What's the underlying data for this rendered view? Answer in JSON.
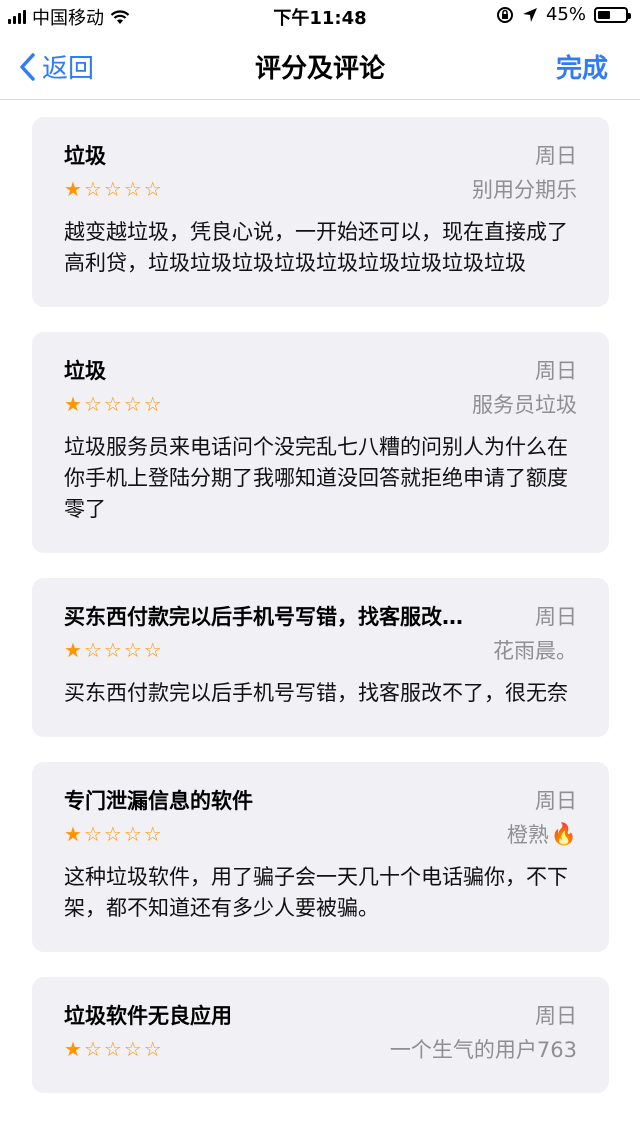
{
  "status_bar": {
    "carrier": "中国移动",
    "time": "下午11:48",
    "battery": "45%",
    "battery_level": 0.45
  },
  "nav": {
    "back_label": "返回",
    "title": "评分及评论",
    "done_label": "完成"
  },
  "reviews": [
    {
      "title": "垃圾",
      "date": "周日",
      "rating": 1,
      "author": "别用分期乐",
      "body": "越变越垃圾，凭良心说，一开始还可以，现在直接成了高利贷，垃圾垃圾垃圾垃圾垃圾垃圾垃圾垃圾垃圾"
    },
    {
      "title": "垃圾",
      "date": "周日",
      "rating": 1,
      "author": "服务员垃圾",
      "body": "垃圾服务员来电话问个没完乱七八糟的问别人为什么在你手机上登陆分期了我哪知道没回答就拒绝申请了额度零了"
    },
    {
      "title": "买东西付款完以后手机号写错，找客服改…",
      "date": "周日",
      "rating": 1,
      "author": "花雨晨。",
      "body": "买东西付款完以后手机号写错，找客服改不了，很无奈"
    },
    {
      "title": "专门泄漏信息的软件",
      "date": "周日",
      "rating": 1,
      "author": "橙熟",
      "author_emoji": "🔥",
      "body": "这种垃圾软件，用了骗子会一天几十个电话骗你，不下架，都不知道还有多少人要被骗。"
    },
    {
      "title": "垃圾软件无良应用",
      "date": "周日",
      "rating": 1,
      "author": "一个生气的用户763",
      "body": ""
    }
  ],
  "colors": {
    "accent": "#2f7cf6",
    "star": "#ff9500",
    "card_bg": "#f0f0f5",
    "secondary_text": "#8e8e93"
  }
}
